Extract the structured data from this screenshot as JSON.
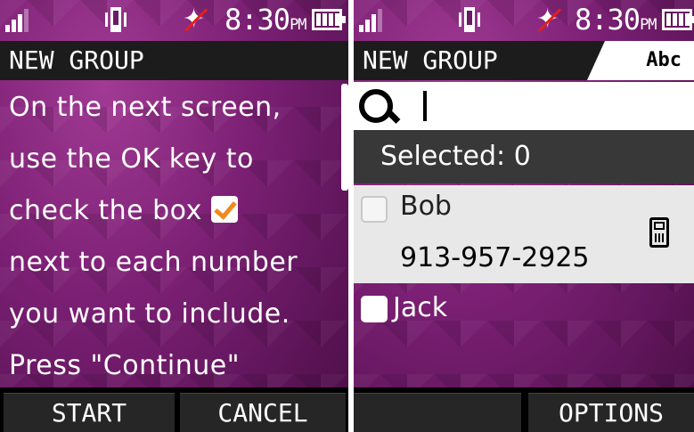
{
  "left": {
    "status": {
      "time": "8:30",
      "ampm": "PM"
    },
    "title": "NEW GROUP",
    "message": {
      "line1": "On the next screen,",
      "line2": "use the OK key to",
      "line3": "check the box",
      "line4": "next to each number",
      "line5": "you want to include.",
      "line6": "Press \"Continue\""
    },
    "softkeys": {
      "left": "START",
      "right": "CANCEL"
    }
  },
  "right": {
    "status": {
      "time": "8:30",
      "ampm": "PM"
    },
    "title": "NEW GROUP",
    "input_mode": "Abc",
    "search": {
      "value": ""
    },
    "selected_label": "Selected: 0",
    "contacts": [
      {
        "name": "Bob",
        "number": "913-957-2925",
        "checked": false,
        "icon": "phone-icon"
      },
      {
        "name": "Jack",
        "checked": false
      }
    ],
    "softkeys": {
      "left": "",
      "right": "OPTIONS"
    }
  },
  "colors": {
    "accent_check": "#f08a1c",
    "background": "#7a1f73"
  }
}
